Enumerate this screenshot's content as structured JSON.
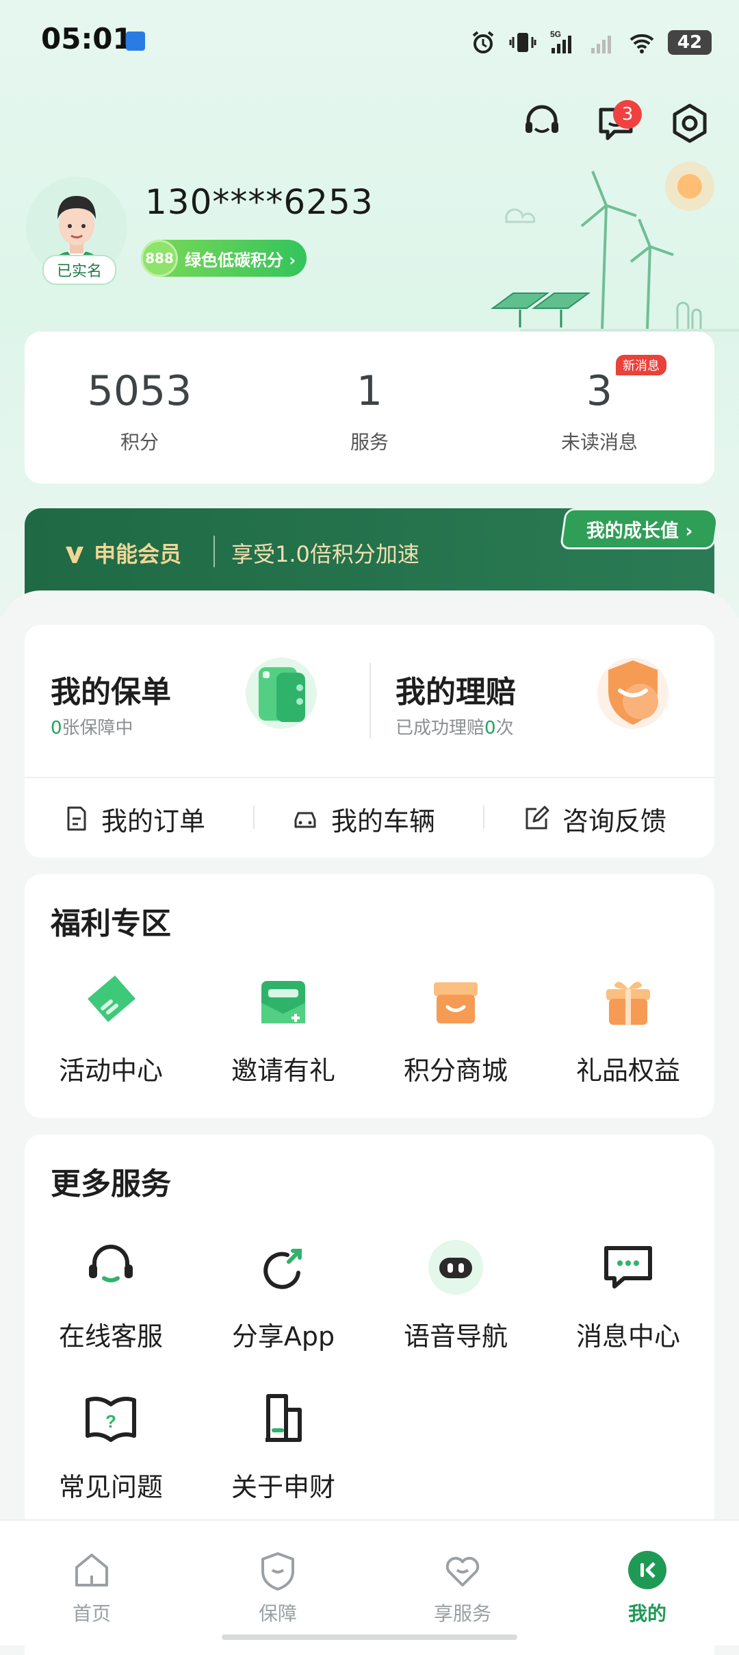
{
  "status_bar": {
    "time": "05:01",
    "battery": "42"
  },
  "header": {
    "message_badge": "3"
  },
  "profile": {
    "phone": "130****6253",
    "verified_label": "已实名",
    "carbon_points": "888",
    "carbon_label": "绿色低碳积分 ›"
  },
  "stats": {
    "items": [
      {
        "value": "5053",
        "label": "积分"
      },
      {
        "value": "1",
        "label": "服务"
      },
      {
        "value": "3",
        "label": "未读消息"
      }
    ],
    "new_badge": "新消息"
  },
  "membership": {
    "brand": "申能会员",
    "perk": "享受1.0倍积分加速",
    "growth_button": "我的成长值 ›"
  },
  "policy": {
    "my_policy_title": "我的保单",
    "my_policy_count": "0",
    "my_policy_suffix": "张保障中",
    "my_claims_title": "我的理赔",
    "my_claims_prefix": "已成功理赔",
    "my_claims_count": "0",
    "my_claims_suffix": "次",
    "quick_links": [
      "我的订单",
      "我的车辆",
      "咨询反馈"
    ]
  },
  "welfare": {
    "title": "福利专区",
    "items": [
      "活动中心",
      "邀请有礼",
      "积分商城",
      "礼品权益"
    ]
  },
  "more_services": {
    "title": "更多服务",
    "items": [
      "在线客服",
      "分享App",
      "语音导航",
      "消息中心",
      "常见问题",
      "关于申财"
    ]
  },
  "tabbar": {
    "tabs": [
      "首页",
      "保障",
      "享服务",
      "我的"
    ],
    "active": "我的"
  },
  "colors": {
    "brand_green": "#1f9a55",
    "member_bg": "#1f6a45",
    "badge_red": "#f04141"
  }
}
